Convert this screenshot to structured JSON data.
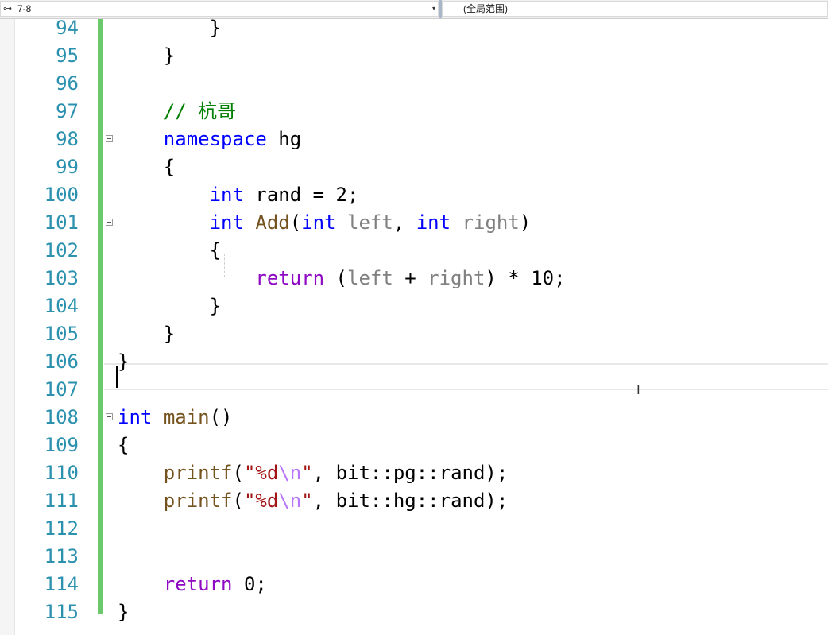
{
  "navbar": {
    "project_icon": "project-scope-icon",
    "project_label": "7-8",
    "dropdown_arrow": "▾",
    "scope_label": "(全局范围)"
  },
  "editor": {
    "lines": [
      {
        "num": "94",
        "segs": [
          {
            "t": "        }",
            "c": ""
          }
        ]
      },
      {
        "num": "95",
        "segs": [
          {
            "t": "    }",
            "c": ""
          }
        ]
      },
      {
        "num": "96",
        "segs": []
      },
      {
        "num": "97",
        "segs": [
          {
            "t": "    ",
            "c": ""
          },
          {
            "t": "// 杭哥",
            "c": "cm"
          }
        ]
      },
      {
        "num": "98",
        "fold": true,
        "segs": [
          {
            "t": "    ",
            "c": ""
          },
          {
            "t": "namespace",
            "c": "kw"
          },
          {
            "t": " hg",
            "c": ""
          }
        ]
      },
      {
        "num": "99",
        "segs": [
          {
            "t": "    {",
            "c": ""
          }
        ]
      },
      {
        "num": "100",
        "segs": [
          {
            "t": "        ",
            "c": ""
          },
          {
            "t": "int",
            "c": "kw"
          },
          {
            "t": " rand = 2;",
            "c": ""
          }
        ]
      },
      {
        "num": "101",
        "fold": true,
        "segs": [
          {
            "t": "        ",
            "c": ""
          },
          {
            "t": "int",
            "c": "kw"
          },
          {
            "t": " ",
            "c": ""
          },
          {
            "t": "Add",
            "c": "fn"
          },
          {
            "t": "(",
            "c": ""
          },
          {
            "t": "int",
            "c": "kw"
          },
          {
            "t": " ",
            "c": ""
          },
          {
            "t": "left",
            "c": "par"
          },
          {
            "t": ", ",
            "c": ""
          },
          {
            "t": "int",
            "c": "kw"
          },
          {
            "t": " ",
            "c": ""
          },
          {
            "t": "right",
            "c": "par"
          },
          {
            "t": ")",
            "c": ""
          }
        ]
      },
      {
        "num": "102",
        "segs": [
          {
            "t": "        {",
            "c": ""
          }
        ]
      },
      {
        "num": "103",
        "segs": [
          {
            "t": "            ",
            "c": ""
          },
          {
            "t": "return",
            "c": "kw2"
          },
          {
            "t": " (",
            "c": ""
          },
          {
            "t": "left",
            "c": "par"
          },
          {
            "t": " + ",
            "c": ""
          },
          {
            "t": "right",
            "c": "par"
          },
          {
            "t": ") * 10;",
            "c": ""
          }
        ]
      },
      {
        "num": "104",
        "segs": [
          {
            "t": "        }",
            "c": ""
          }
        ]
      },
      {
        "num": "105",
        "segs": [
          {
            "t": "    }",
            "c": ""
          }
        ]
      },
      {
        "num": "106",
        "segs": [
          {
            "t": "}",
            "c": ""
          }
        ]
      },
      {
        "num": "107",
        "segs": []
      },
      {
        "num": "108",
        "fold": true,
        "segs": [
          {
            "t": "int",
            "c": "kw"
          },
          {
            "t": " ",
            "c": ""
          },
          {
            "t": "main",
            "c": "fn"
          },
          {
            "t": "()",
            "c": ""
          }
        ]
      },
      {
        "num": "109",
        "segs": [
          {
            "t": "{",
            "c": ""
          }
        ]
      },
      {
        "num": "110",
        "segs": [
          {
            "t": "    ",
            "c": ""
          },
          {
            "t": "printf",
            "c": "fn"
          },
          {
            "t": "(",
            "c": ""
          },
          {
            "t": "\"%d",
            "c": "str"
          },
          {
            "t": "\\n",
            "c": "esc"
          },
          {
            "t": "\"",
            "c": "str"
          },
          {
            "t": ", bit::pg::rand);",
            "c": ""
          }
        ]
      },
      {
        "num": "111",
        "segs": [
          {
            "t": "    ",
            "c": ""
          },
          {
            "t": "printf",
            "c": "fn"
          },
          {
            "t": "(",
            "c": ""
          },
          {
            "t": "\"%d",
            "c": "str"
          },
          {
            "t": "\\n",
            "c": "esc"
          },
          {
            "t": "\"",
            "c": "str"
          },
          {
            "t": ", bit::hg::rand);",
            "c": ""
          }
        ]
      },
      {
        "num": "112",
        "segs": []
      },
      {
        "num": "113",
        "segs": []
      },
      {
        "num": "114",
        "segs": [
          {
            "t": "    ",
            "c": ""
          },
          {
            "t": "return",
            "c": "kw2"
          },
          {
            "t": " 0;",
            "c": ""
          }
        ]
      },
      {
        "num": "115",
        "segs": [
          {
            "t": "}",
            "c": ""
          }
        ]
      }
    ]
  },
  "colors": {
    "line_number": "#2b91af",
    "keyword": "#0000ff",
    "control_keyword": "#8f08c4",
    "comment": "#008000",
    "function": "#74531f",
    "string": "#a31515",
    "parameter": "#808080",
    "change_bar": "#6bc96b"
  }
}
